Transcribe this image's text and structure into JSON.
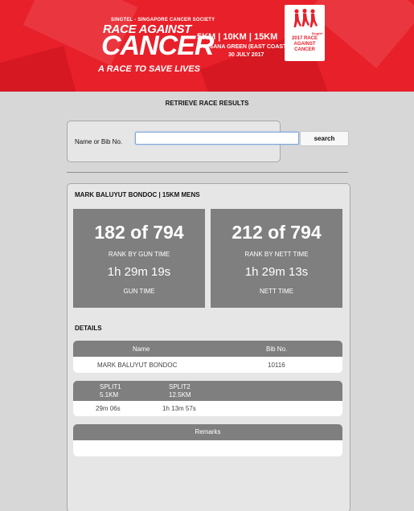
{
  "banner": {
    "org_line": "SINGTEL - SINGAPORE CANCER SOCIETY",
    "logo_line1": "RACE AGAINST",
    "logo_line2": "CANCER",
    "tagline": "A RACE TO SAVE LIVES",
    "distances": "5KM | 10KM | 15KM",
    "venue": "ANGSANA GREEN (EAST COAST PARK)",
    "date": "30 JULY 2017",
    "badge_sponsor": "Singtel",
    "badge_title": "2017 RACE AGAINST CANCER",
    "brand_color": "#e8202a"
  },
  "page": {
    "heading": "RETRIEVE RACE RESULTS"
  },
  "search": {
    "label": "Name or Bib No.",
    "value": "",
    "placeholder": "",
    "button_label": "search"
  },
  "result": {
    "runner_line": "MARK BALUYUT BONDOC | 15KM MENS",
    "gun": {
      "rank": "182 of 794",
      "rank_label": "RANK BY GUN TIME",
      "time": "1h 29m 19s",
      "time_label": "GUN TIME"
    },
    "nett": {
      "rank": "212 of 794",
      "rank_label": "RANK BY NETT TIME",
      "time": "1h 29m 13s",
      "time_label": "NETT TIME"
    },
    "details_title": "DETAILS",
    "info_table": {
      "headers": [
        "Name",
        "Bib No."
      ],
      "row": [
        "MARK BALUYUT BONDOC",
        "10116"
      ]
    },
    "splits_table": {
      "headers": [
        {
          "line1": "SPLIT1",
          "line2": "5.1KM"
        },
        {
          "line1": "SPLIT2",
          "line2": "12.5KM"
        }
      ],
      "row": [
        "29m 06s",
        "1h 13m 57s"
      ]
    },
    "remarks_table": {
      "header": "Remarks",
      "value": ""
    },
    "panel_color": "#7f7f7f"
  }
}
